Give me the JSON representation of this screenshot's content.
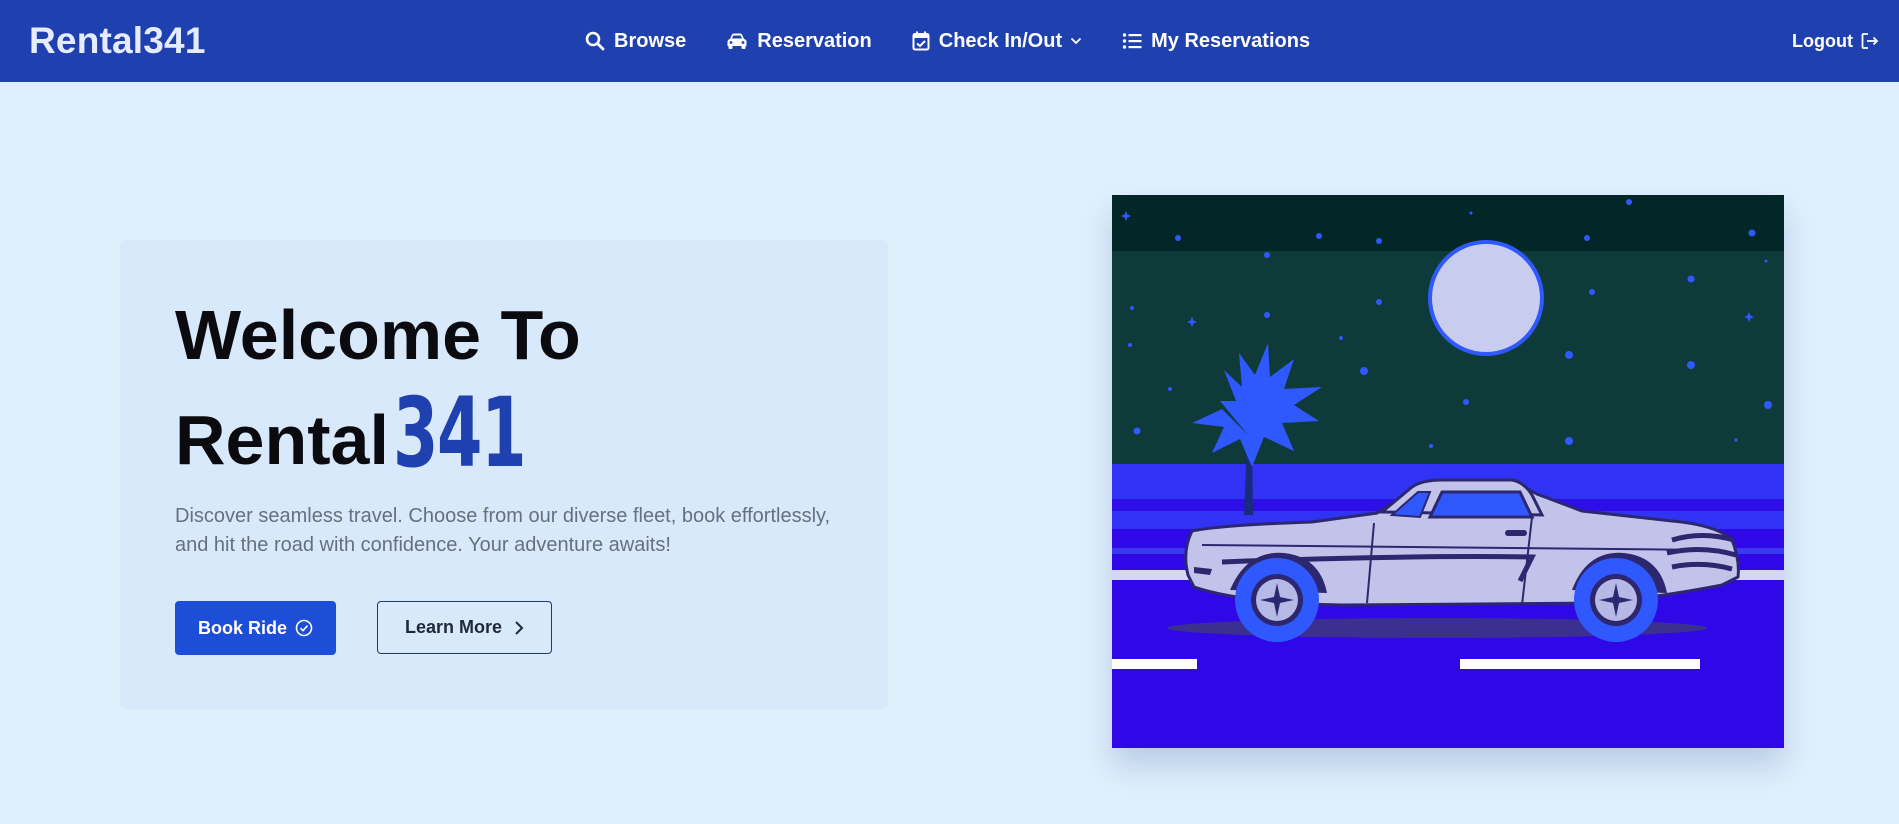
{
  "navbar": {
    "brand": "Rental341",
    "links": [
      {
        "label": "Browse",
        "icon": "search-icon"
      },
      {
        "label": "Reservation",
        "icon": "car-icon"
      },
      {
        "label": "Check In/Out",
        "icon": "calendar-check-icon",
        "dropdown": true
      },
      {
        "label": "My Reservations",
        "icon": "list-icon"
      }
    ],
    "logout": "Logout"
  },
  "hero": {
    "title_line1": "Welcome To",
    "title_word": "Rental",
    "title_number": "341",
    "description": "Discover seamless travel. Choose from our diverse fleet, book effortlessly, and hit the road with confidence. Your adventure awaits!",
    "primary_button": "Book Ride",
    "secondary_button": "Learn More"
  },
  "illustration": {
    "subject": "night-car-illustration"
  },
  "colors": {
    "page_bg": "#dff0fd",
    "navbar_bg": "#1f40af",
    "accent": "#1d4ed8",
    "card_bg": "#d9e9fc",
    "sky": "#0f3a3a",
    "road": "#3008e8"
  }
}
